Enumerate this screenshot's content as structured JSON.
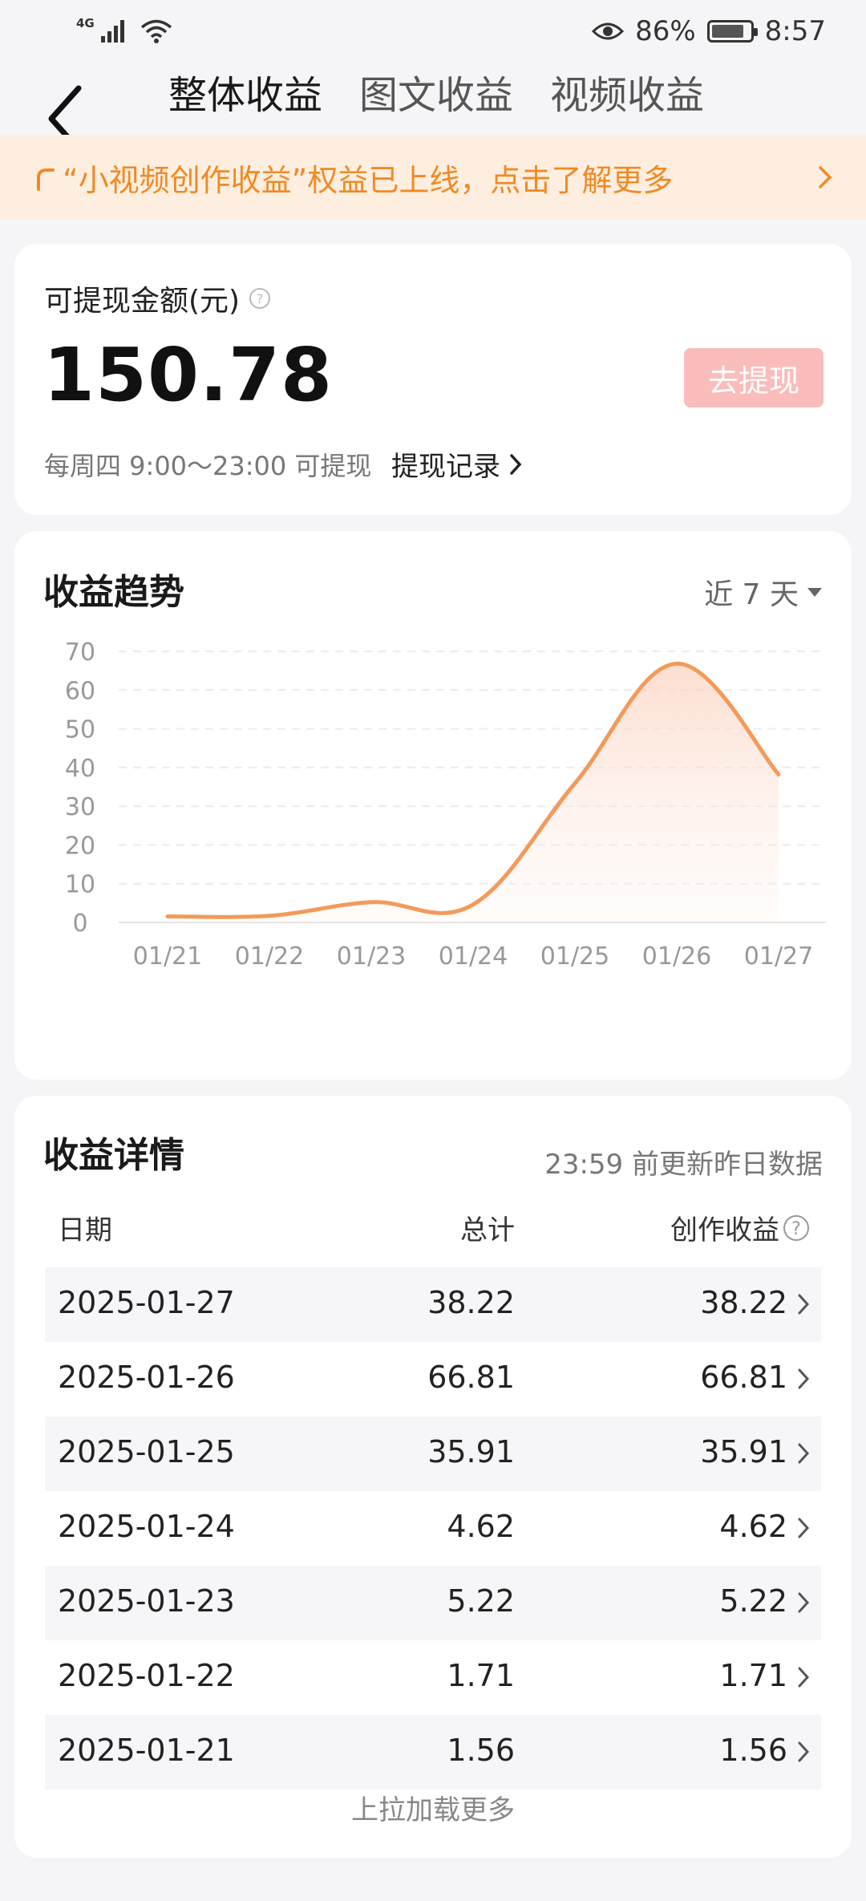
{
  "status_bar": {
    "network": "4G",
    "battery_percent": "86%",
    "battery_level": 0.86,
    "time": "8:57",
    "icons": [
      "signal-icon",
      "wifi-icon",
      "eye-protection-icon",
      "battery-icon"
    ]
  },
  "header": {
    "tabs": [
      {
        "label": "整体收益",
        "active": true
      },
      {
        "label": "图文收益",
        "active": false
      },
      {
        "label": "视频收益",
        "active": false
      }
    ]
  },
  "banner": {
    "text": "“小视频创作收益”权益已上线，点击了解更多",
    "color": "#f08a24",
    "background": "#fdeedf"
  },
  "balance": {
    "label": "可提现金额(元)",
    "amount": "150.78",
    "withdraw_label": "去提现",
    "withdraw_color": "#fbbcbc",
    "hint": "每周四 9:00～23:00 可提现",
    "record_label": "提现记录"
  },
  "trend": {
    "title": "收益趋势",
    "range_label": "近 7 天"
  },
  "chart_data": {
    "type": "area",
    "categories": [
      "01/21",
      "01/22",
      "01/23",
      "01/24",
      "01/25",
      "01/26",
      "01/27"
    ],
    "values": [
      1.56,
      1.71,
      5.22,
      4.62,
      35.91,
      66.81,
      38.22
    ],
    "ylim": [
      0,
      70
    ],
    "yticks": [
      0,
      10,
      20,
      30,
      40,
      50,
      60,
      70
    ],
    "grid": true,
    "line_color": "#f39a5a",
    "smooth": true
  },
  "detail": {
    "title": "收益详情",
    "update_note": "23:59 前更新昨日数据",
    "columns": [
      "日期",
      "总计",
      "创作收益"
    ],
    "rows": [
      {
        "date": "2025-01-27",
        "total": "38.22",
        "creation": "38.22"
      },
      {
        "date": "2025-01-26",
        "total": "66.81",
        "creation": "66.81"
      },
      {
        "date": "2025-01-25",
        "total": "35.91",
        "creation": "35.91"
      },
      {
        "date": "2025-01-24",
        "total": "4.62",
        "creation": "4.62"
      },
      {
        "date": "2025-01-23",
        "total": "5.22",
        "creation": "5.22"
      },
      {
        "date": "2025-01-22",
        "total": "1.71",
        "creation": "1.71"
      },
      {
        "date": "2025-01-21",
        "total": "1.56",
        "creation": "1.56"
      }
    ],
    "load_more": "上拉加载更多"
  }
}
